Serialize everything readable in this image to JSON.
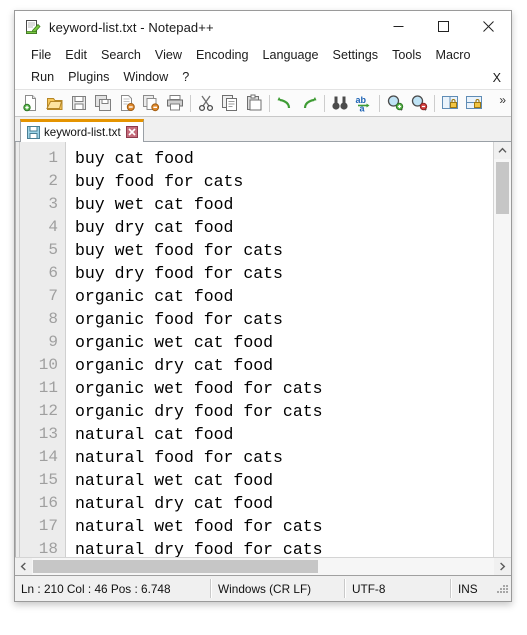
{
  "window": {
    "title": "keyword-list.txt - Notepad++",
    "icon": "notepad-plus-plus-icon",
    "controls": {
      "minimize": "minimize-icon",
      "maximize": "maximize-icon",
      "close": "close-icon"
    }
  },
  "menubar": {
    "items": [
      "File",
      "Edit",
      "Search",
      "View",
      "Encoding",
      "Language",
      "Settings",
      "Tools",
      "Macro",
      "Run",
      "Plugins",
      "Window",
      "?"
    ],
    "close_document_label": "X"
  },
  "toolbar": {
    "overflow_label": "»",
    "buttons": [
      "new-file-icon",
      "open-file-icon",
      "save-icon",
      "save-all-icon",
      "close-file-icon",
      "close-all-files-icon",
      "print-icon",
      "sep",
      "cut-icon",
      "copy-icon",
      "paste-icon",
      "sep",
      "undo-icon",
      "redo-icon",
      "sep",
      "find-icon",
      "replace-icon",
      "sep",
      "zoom-in-icon",
      "zoom-out-icon",
      "sep",
      "sync-vertical-scroll-icon",
      "sync-horizontal-scroll-icon"
    ]
  },
  "tabs": [
    {
      "label": "keyword-list.txt",
      "icon": "save-document-icon",
      "close": "tab-close-icon",
      "active": true
    }
  ],
  "editor": {
    "lines": [
      {
        "number": "1",
        "text": "buy cat food"
      },
      {
        "number": "2",
        "text": "buy food for cats"
      },
      {
        "number": "3",
        "text": "buy wet cat food"
      },
      {
        "number": "4",
        "text": "buy dry cat food"
      },
      {
        "number": "5",
        "text": "buy wet food for cats"
      },
      {
        "number": "6",
        "text": "buy dry food for cats"
      },
      {
        "number": "7",
        "text": "organic cat food"
      },
      {
        "number": "8",
        "text": "organic food for cats"
      },
      {
        "number": "9",
        "text": "organic wet cat food"
      },
      {
        "number": "10",
        "text": "organic dry cat food"
      },
      {
        "number": "11",
        "text": "organic wet food for cats"
      },
      {
        "number": "12",
        "text": "organic dry food for cats"
      },
      {
        "number": "13",
        "text": "natural cat food"
      },
      {
        "number": "14",
        "text": "natural food for cats"
      },
      {
        "number": "15",
        "text": "natural wet cat food"
      },
      {
        "number": "16",
        "text": "natural dry cat food"
      },
      {
        "number": "17",
        "text": "natural wet food for cats"
      },
      {
        "number": "18",
        "text": "natural dry food for cats"
      }
    ]
  },
  "scrollbars": {
    "vertical": {
      "up_arrow": "chevron-up-icon",
      "down_arrow": "chevron-down-icon"
    },
    "horizontal": {
      "left_arrow": "chevron-left-icon",
      "right_arrow": "chevron-right-icon"
    }
  },
  "statusbar": {
    "position": "Ln : 210   Col : 46   Pos : 6.748",
    "eol": "Windows (CR LF)",
    "encoding": "UTF-8",
    "insert_mode": "INS"
  },
  "colors": {
    "tab_accent": "#e59400",
    "gutter_bg": "#ececec",
    "line_number": "#9f9f9f",
    "text": "#000000",
    "statusbar_bg": "#f0f0f0"
  }
}
